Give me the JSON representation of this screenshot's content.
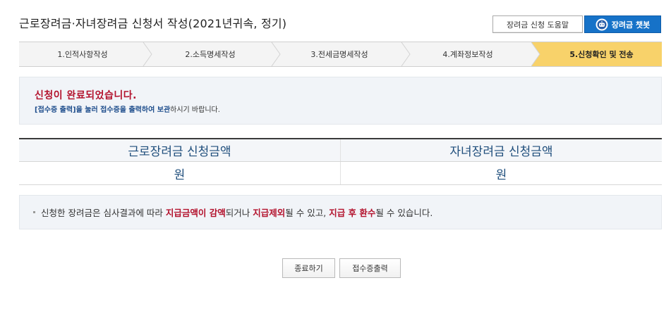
{
  "header": {
    "title": "근로장려금·자녀장려금 신청서 작성(2021년귀속, 정기)",
    "help_label": "장려금 신청 도움말",
    "chatbot_label": "장려금 챗봇"
  },
  "steps": [
    {
      "label": "1.인적사항작성",
      "active": false
    },
    {
      "label": "2.소득명세작성",
      "active": false
    },
    {
      "label": "3.전세금명세작성",
      "active": false
    },
    {
      "label": "4.계좌정보작성",
      "active": false
    },
    {
      "label": "5.신청확인 및 전송",
      "active": true
    }
  ],
  "notice": {
    "title": "신청이 완료되었습니다.",
    "desc_highlight": "[접수증 출력]을 눌러 접수증을 출력하여 보관",
    "desc_rest": "하시기 바랍니다."
  },
  "amounts": {
    "headers": [
      "근로장려금 신청금액",
      "자녀장려금 신청금액"
    ],
    "values": [
      "원",
      "원"
    ]
  },
  "info": {
    "part1": "신청한 장려금은 심사결과에 따라 ",
    "red1": "지급금액이 감액",
    "part2": "되거나 ",
    "red2": "지급제외",
    "part3": "될 수 있고, ",
    "red3": "지급 후 환수",
    "part4": "될 수 있습니다."
  },
  "buttons": {
    "close": "종료하기",
    "print": "접수증출력"
  },
  "colors": {
    "accent_blue": "#1672c8",
    "alert_red": "#b3122d",
    "active_step": "#f8d26a"
  }
}
